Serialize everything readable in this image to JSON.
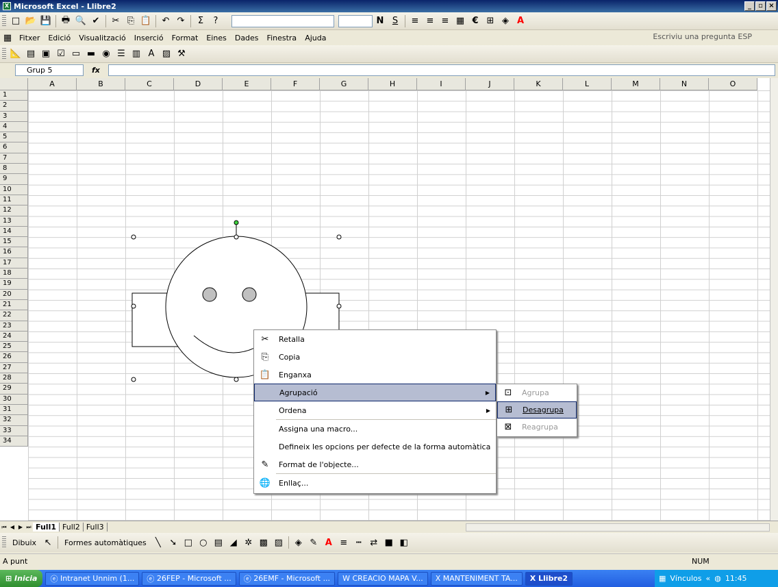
{
  "window": {
    "title": "Microsoft Excel - Llibre2"
  },
  "menus": [
    "Fitxer",
    "Edició",
    "Visualització",
    "Inserció",
    "Format",
    "Eines",
    "Dades",
    "Finestra",
    "Ajuda"
  ],
  "help_search": "Escriviu una pregunta ESP",
  "formula": {
    "name_box": "Grup 5",
    "fx": "fx"
  },
  "toolbar": {
    "bold": "N",
    "underline": "S",
    "euro": "€"
  },
  "columns": [
    "A",
    "B",
    "C",
    "D",
    "E",
    "F",
    "G",
    "H",
    "I",
    "J",
    "K",
    "L",
    "M",
    "N",
    "O"
  ],
  "rows": [
    "1",
    "2",
    "3",
    "4",
    "5",
    "6",
    "7",
    "8",
    "9",
    "10",
    "11",
    "12",
    "13",
    "14",
    "15",
    "16",
    "17",
    "18",
    "19",
    "20",
    "21",
    "22",
    "23",
    "24",
    "25",
    "26",
    "27",
    "28",
    "29",
    "30",
    "31",
    "32",
    "33",
    "34"
  ],
  "sheets": [
    "Full1",
    "Full2",
    "Full3"
  ],
  "context_menu": {
    "items": [
      {
        "label": "Retalla",
        "icon": "scissors-icon"
      },
      {
        "label": "Copia",
        "icon": "copy-icon"
      },
      {
        "label": "Enganxa",
        "icon": "paste-icon"
      },
      {
        "label": "Agrupació",
        "icon": "",
        "submenu": true
      },
      {
        "label": "Ordena",
        "icon": "",
        "submenu": true
      },
      {
        "label": "Assigna una macro...",
        "icon": ""
      },
      {
        "label": "Defineix les opcions per defecte de la forma automàtica",
        "icon": ""
      },
      {
        "label": "Format de l'objecte...",
        "icon": "format-object-icon"
      },
      {
        "label": "Enllaç...",
        "icon": "link-icon"
      }
    ]
  },
  "submenu": {
    "items": [
      {
        "label": "Agrupa",
        "enabled": false
      },
      {
        "label": "Desagrupa",
        "enabled": true
      },
      {
        "label": "Reagrupa",
        "enabled": false
      }
    ]
  },
  "drawing_toolbar": {
    "draw": "Dibuix",
    "autoshapes": "Formes automàtiques"
  },
  "status": {
    "mode": "A punt",
    "num": "NUM"
  },
  "taskbar": {
    "start": "Inicia",
    "tasks": [
      "Intranet Unnim (1...",
      "26FEP - Microsoft ...",
      "26EMF - Microsoft ...",
      "CREACIO MAPA V...",
      "MANTENIMENT TA...",
      "Llibre2"
    ],
    "tray_label": "Vínculos",
    "clock": "11:45"
  }
}
